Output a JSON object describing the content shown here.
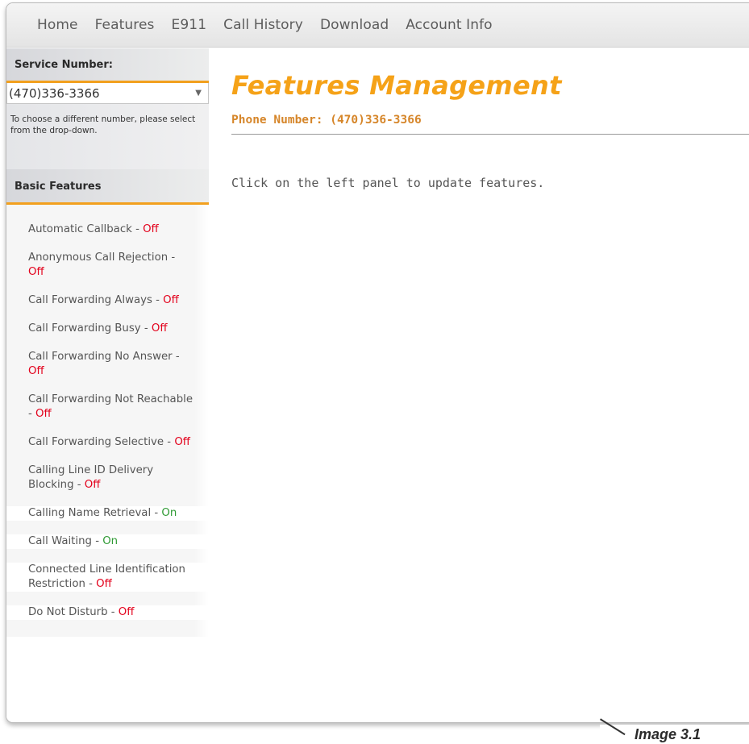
{
  "nav": {
    "items": [
      "Home",
      "Features",
      "E911",
      "Call History",
      "Download",
      "Account Info"
    ]
  },
  "sidebar": {
    "service_heading": "Service Number:",
    "selected_number": "(470)336-3366",
    "help_text": "To choose a different number, please select from the drop-down.",
    "features_heading": "Basic Features",
    "features": [
      {
        "name": "Automatic Callback - ",
        "status": "Off"
      },
      {
        "name": "Anonymous Call Rejection - ",
        "status": "Off"
      },
      {
        "name": "Call Forwarding Always - ",
        "status": "Off"
      },
      {
        "name": "Call Forwarding Busy - ",
        "status": "Off"
      },
      {
        "name": "Call Forwarding No Answer - ",
        "status": "Off"
      },
      {
        "name": "Call Forwarding Not Reachable - ",
        "status": "Off"
      },
      {
        "name": "Call Forwarding Selective - ",
        "status": "Off"
      },
      {
        "name": "Calling Line ID Delivery Blocking - ",
        "status": "Off"
      },
      {
        "name": "Calling Name Retrieval - ",
        "status": "On"
      },
      {
        "name": "Call Waiting - ",
        "status": "On"
      },
      {
        "name": "Connected Line Identification Restriction - ",
        "status": "Off"
      },
      {
        "name": "Do Not Disturb - ",
        "status": "Off"
      }
    ]
  },
  "main": {
    "title": "Features Management",
    "phone_label": "Phone Number: (470)336-3366",
    "hint": "Click on the left panel to update features."
  },
  "caption": "Image 3.1",
  "colors": {
    "accent": "#f5a218",
    "off": "#e3001b",
    "on": "#2f9a34"
  }
}
